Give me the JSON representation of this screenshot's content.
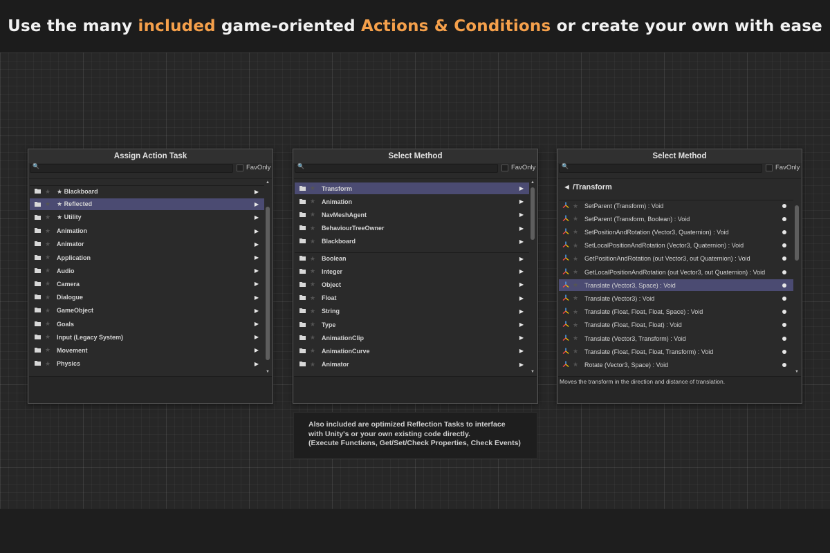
{
  "banner": {
    "part1": "Use the many ",
    "accent1": "included",
    "part2": " game-oriented ",
    "accent2": "Actions & Conditions",
    "part3": " or create your own with ease",
    "accent_color": "#f5a04b"
  },
  "panel_left": {
    "title": "Assign Action Task",
    "fav_label": "FavOnly",
    "items": [
      {
        "label": "★ Blackboard",
        "selected": false
      },
      {
        "label": "★ Reflected",
        "selected": true
      },
      {
        "label": "★ Utility",
        "selected": false
      },
      {
        "label": "Animation",
        "selected": false
      },
      {
        "label": "Animator",
        "selected": false
      },
      {
        "label": "Application",
        "selected": false
      },
      {
        "label": "Audio",
        "selected": false
      },
      {
        "label": "Camera",
        "selected": false
      },
      {
        "label": "Dialogue",
        "selected": false
      },
      {
        "label": "GameObject",
        "selected": false
      },
      {
        "label": "Goals",
        "selected": false
      },
      {
        "label": "Input (Legacy System)",
        "selected": false
      },
      {
        "label": "Movement",
        "selected": false
      },
      {
        "label": "Physics",
        "selected": false
      }
    ]
  },
  "panel_middle": {
    "title": "Select Method",
    "fav_label": "FavOnly",
    "items": [
      {
        "label": "Transform",
        "selected": true
      },
      {
        "label": "Animation",
        "selected": false
      },
      {
        "label": "NavMeshAgent",
        "selected": false
      },
      {
        "label": "BehaviourTreeOwner",
        "selected": false
      },
      {
        "label": "Blackboard",
        "selected": false
      },
      {
        "label": "Boolean",
        "selected": false
      },
      {
        "label": "Integer",
        "selected": false
      },
      {
        "label": "Object",
        "selected": false
      },
      {
        "label": "Float",
        "selected": false
      },
      {
        "label": "String",
        "selected": false
      },
      {
        "label": "Type",
        "selected": false
      },
      {
        "label": "AnimationClip",
        "selected": false
      },
      {
        "label": "AnimationCurve",
        "selected": false
      },
      {
        "label": "Animator",
        "selected": false
      }
    ]
  },
  "panel_right": {
    "title": "Select Method",
    "fav_label": "FavOnly",
    "path": "◄ /Transform",
    "items": [
      {
        "label": "SetParent (Transform) : Void",
        "selected": false
      },
      {
        "label": "SetParent (Transform, Boolean) : Void",
        "selected": false
      },
      {
        "label": "SetPositionAndRotation (Vector3, Quaternion) : Void",
        "selected": false
      },
      {
        "label": "SetLocalPositionAndRotation (Vector3, Quaternion) : Void",
        "selected": false
      },
      {
        "label": "GetPositionAndRotation (out Vector3, out Quaternion) : Void",
        "selected": false
      },
      {
        "label": "GetLocalPositionAndRotation (out Vector3, out Quaternion) : Void",
        "selected": false
      },
      {
        "label": "Translate (Vector3, Space) : Void",
        "selected": true
      },
      {
        "label": "Translate (Vector3) : Void",
        "selected": false
      },
      {
        "label": "Translate (Float, Float, Float, Space) : Void",
        "selected": false
      },
      {
        "label": "Translate (Float, Float, Float) : Void",
        "selected": false
      },
      {
        "label": "Translate (Vector3, Transform) : Void",
        "selected": false
      },
      {
        "label": "Translate (Float, Float, Float, Transform) : Void",
        "selected": false
      },
      {
        "label": "Rotate (Vector3, Space) : Void",
        "selected": false
      }
    ],
    "description": "Moves the transform in the direction and distance of translation."
  },
  "info_box": {
    "line1": "Also included are optimized Reflection Tasks to interface",
    "line2": "with Unity's or your own existing code directly.",
    "line3": "(Execute Functions, Get/Set/Check Properties, Check Events)"
  },
  "colors": {
    "selection": "#4b4b72",
    "background": "#242424"
  },
  "icons": {
    "folder": "folder-icon",
    "star": "star-icon",
    "arrow": "arrow-right-icon",
    "method": "transform-axis-icon",
    "search": "search-icon"
  }
}
